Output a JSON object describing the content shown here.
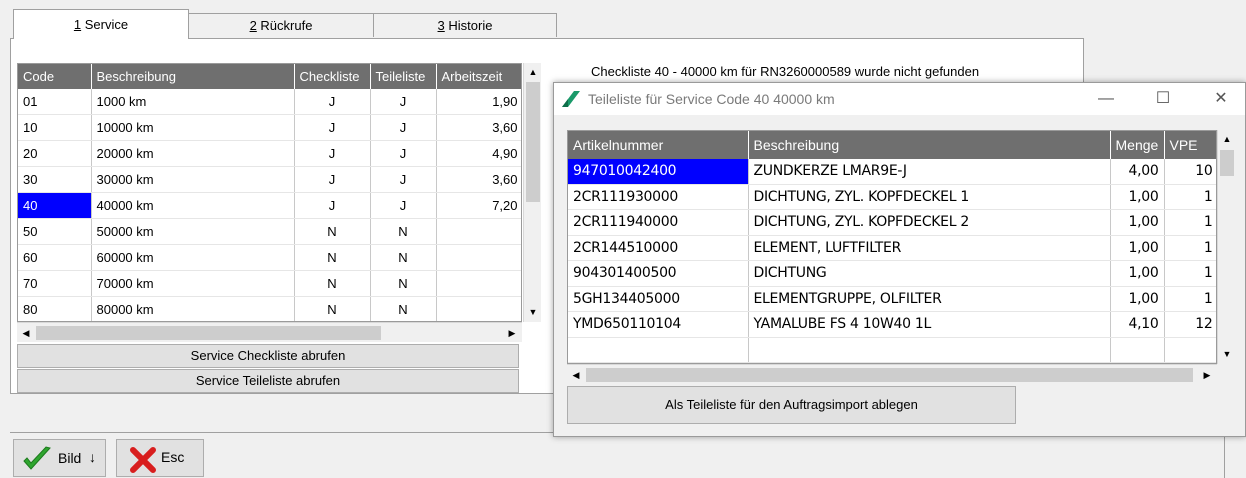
{
  "tabs": [
    {
      "mnemonic": "1",
      "label": " Service"
    },
    {
      "mnemonic": "2",
      "label": " Rückrufe"
    },
    {
      "mnemonic": "3",
      "label": " Historie"
    }
  ],
  "service_grid": {
    "headers": [
      "Code",
      "Beschreibung",
      "Checkliste",
      "Teileliste",
      "Arbeitszeit"
    ],
    "rows": [
      {
        "code": "01",
        "desc": "1000 km",
        "check": "J",
        "parts": "J",
        "time": "1,90"
      },
      {
        "code": "10",
        "desc": "10000 km",
        "check": "J",
        "parts": "J",
        "time": "3,60"
      },
      {
        "code": "20",
        "desc": "20000 km",
        "check": "J",
        "parts": "J",
        "time": "4,90"
      },
      {
        "code": "30",
        "desc": "30000 km",
        "check": "J",
        "parts": "J",
        "time": "3,60"
      },
      {
        "code": "40",
        "desc": "40000 km",
        "check": "J",
        "parts": "J",
        "time": "7,20"
      },
      {
        "code": "50",
        "desc": "50000 km",
        "check": "N",
        "parts": "N",
        "time": ""
      },
      {
        "code": "60",
        "desc": "60000 km",
        "check": "N",
        "parts": "N",
        "time": ""
      },
      {
        "code": "70",
        "desc": "70000 km",
        "check": "N",
        "parts": "N",
        "time": ""
      },
      {
        "code": "80",
        "desc": "80000 km",
        "check": "N",
        "parts": "N",
        "time": ""
      }
    ]
  },
  "buttons": {
    "checklist": "Service Checkliste abrufen",
    "partslist": "Service Teileliste abrufen",
    "bild": "Bild",
    "bild_arrow": "↓",
    "esc": "Esc"
  },
  "message": "Checkliste 40 - 40000 km für RN3260000589 wurde nicht gefunden",
  "popup": {
    "title": "Teileliste für Service Code 40  40000 km",
    "headers": [
      "Artikelnummer",
      "Beschreibung",
      "Menge",
      "VPE"
    ],
    "rows": [
      {
        "art": "947010042400",
        "desc": "ZUNDKERZE LMAR9E-J",
        "qty": "4,00",
        "vpe": "10"
      },
      {
        "art": "2CR111930000",
        "desc": "DICHTUNG, ZYL. KOPFDECKEL 1",
        "qty": "1,00",
        "vpe": "1"
      },
      {
        "art": "2CR111940000",
        "desc": "DICHTUNG, ZYL. KOPFDECKEL 2",
        "qty": "1,00",
        "vpe": "1"
      },
      {
        "art": "2CR144510000",
        "desc": "ELEMENT, LUFTFILTER",
        "qty": "1,00",
        "vpe": "1"
      },
      {
        "art": "904301400500",
        "desc": "DICHTUNG",
        "qty": "1,00",
        "vpe": "1"
      },
      {
        "art": "5GH134405000",
        "desc": "ELEMENTGRUPPE, OLFILTER",
        "qty": "1,00",
        "vpe": "1"
      },
      {
        "art": "YMD650110104",
        "desc": "YAMALUBE FS 4 10W40 1L",
        "qty": "4,10",
        "vpe": "12"
      }
    ],
    "button": "Als Teileliste für den Auftragsimport ablegen"
  },
  "colors": {
    "selection": "#0000ff",
    "header_bg": "#6f6f6f",
    "check_green": "#2fa52f",
    "esc_red": "#d81e1e",
    "logo_green": "#1a9a6a"
  }
}
